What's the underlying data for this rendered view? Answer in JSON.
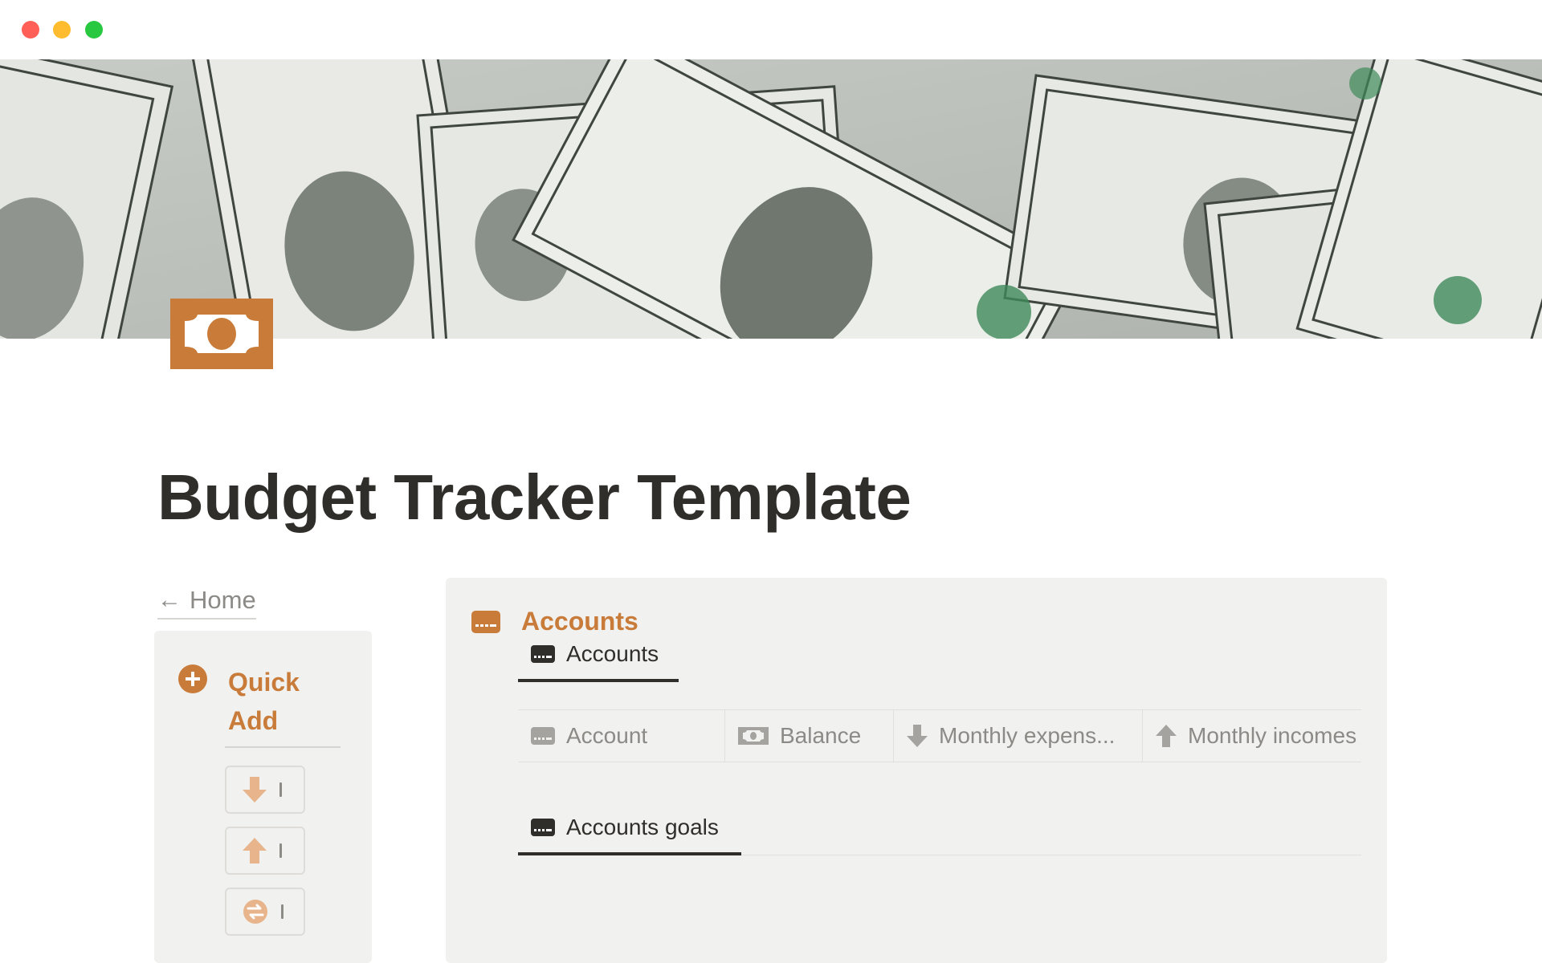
{
  "window": {
    "controls": [
      "close",
      "minimize",
      "maximize"
    ]
  },
  "page": {
    "title": "Budget Tracker Template",
    "icon": "money-banknote-icon",
    "cover": "dollar-bills-photo",
    "accent_color": "#c97c3a"
  },
  "nav": {
    "home_label": "Home",
    "home_arrow": "←"
  },
  "quick_add": {
    "title": "Quick Add",
    "icon": "plus-circle-icon",
    "buttons": [
      {
        "icon": "arrow-down-icon"
      },
      {
        "icon": "arrow-up-icon"
      },
      {
        "icon": "transfer-icon"
      }
    ]
  },
  "accounts": {
    "title": "Accounts",
    "icon": "credit-card-icon",
    "views": [
      {
        "label": "Accounts",
        "icon": "credit-card-icon"
      },
      {
        "label": "Accounts goals",
        "icon": "credit-card-icon"
      }
    ],
    "columns": [
      {
        "label": "Account",
        "icon": "credit-card-icon"
      },
      {
        "label": "Balance",
        "icon": "banknote-icon"
      },
      {
        "label": "Monthly expens...",
        "icon": "arrow-down-icon"
      },
      {
        "label": "Monthly incomes",
        "icon": "arrow-up-icon"
      }
    ]
  }
}
